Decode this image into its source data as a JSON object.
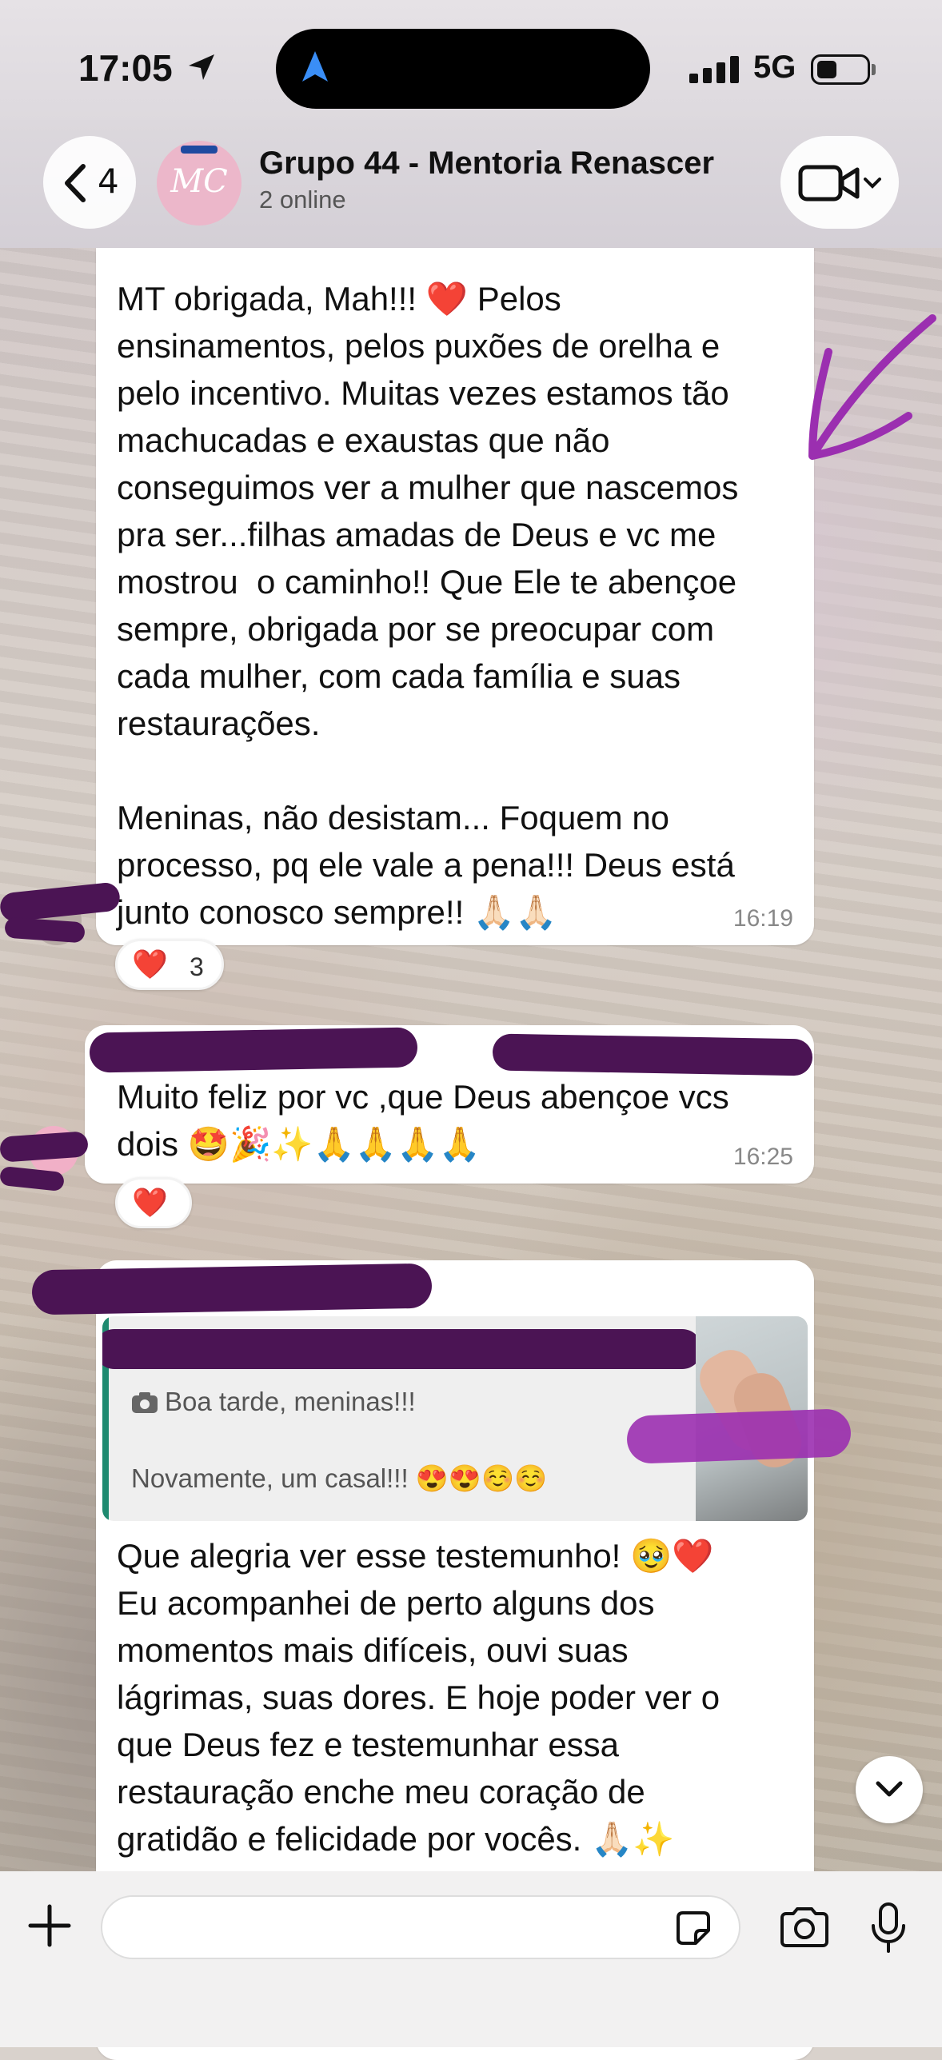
{
  "status_bar": {
    "time": "17:05",
    "network": "5G",
    "icons": [
      "location-arrow-icon",
      "signal-bars-icon",
      "battery-icon"
    ]
  },
  "header": {
    "back_count": "4",
    "avatar_text": "MC",
    "group_name": "Grupo 44 - Mentoria Renascer",
    "subtitle": "2 online",
    "icons": [
      "back-chevron-icon",
      "video-call-icon",
      "chevron-down-icon"
    ]
  },
  "messages": [
    {
      "text": "MT obrigada, Mah!!! ❤️ Pelos\nensinamentos, pelos puxões de orelha e\npelo incentivo. Muitas vezes estamos tão\nmachucadas e exaustas que não\nconseguimos ver a mulher que nascemos\npra ser...filhas amadas de Deus e vc me\nmostrou  o caminho!! Que Ele te abençoe\nsempre, obrigada por se preocupar com\ncada mulher, com cada família e suas\nrestaurações.\n\nMeninas, não desistam... Foquem no\nprocesso, pq ele vale a pena!!! Deus está\njunto conosco sempre!! 🙏🏻🙏🏻",
      "time": "16:19",
      "reaction": {
        "emoji": "❤️",
        "count": "3"
      }
    },
    {
      "text": "Muito feliz por vc ,que Deus abençoe vcs\ndois 🤩🎉✨🙏🙏🙏🙏",
      "time": "16:25",
      "reaction": {
        "emoji": "❤️"
      }
    },
    {
      "quoted": {
        "line1": "Boa tarde, meninas!!!",
        "line2": "Novamente, um casal!!! 😍😍☺️☺️"
      },
      "text": "Que alegria ver esse testemunho! 🥹❤️\nEu acompanhei de perto alguns dos\nmomentos mais difíceis, ouvi suas\nlágrimas, suas dores. E hoje poder ver o\nque Deus fez e testemunhar essa\nrestauração enche meu coração de\ngratidão e felicidade por vocês. 🙏🏻✨"
    }
  ],
  "input": {
    "value": ""
  },
  "colors": {
    "scribble": "#4b1454",
    "accent_reply": "#1f8a70",
    "heart": "#e0192a"
  }
}
